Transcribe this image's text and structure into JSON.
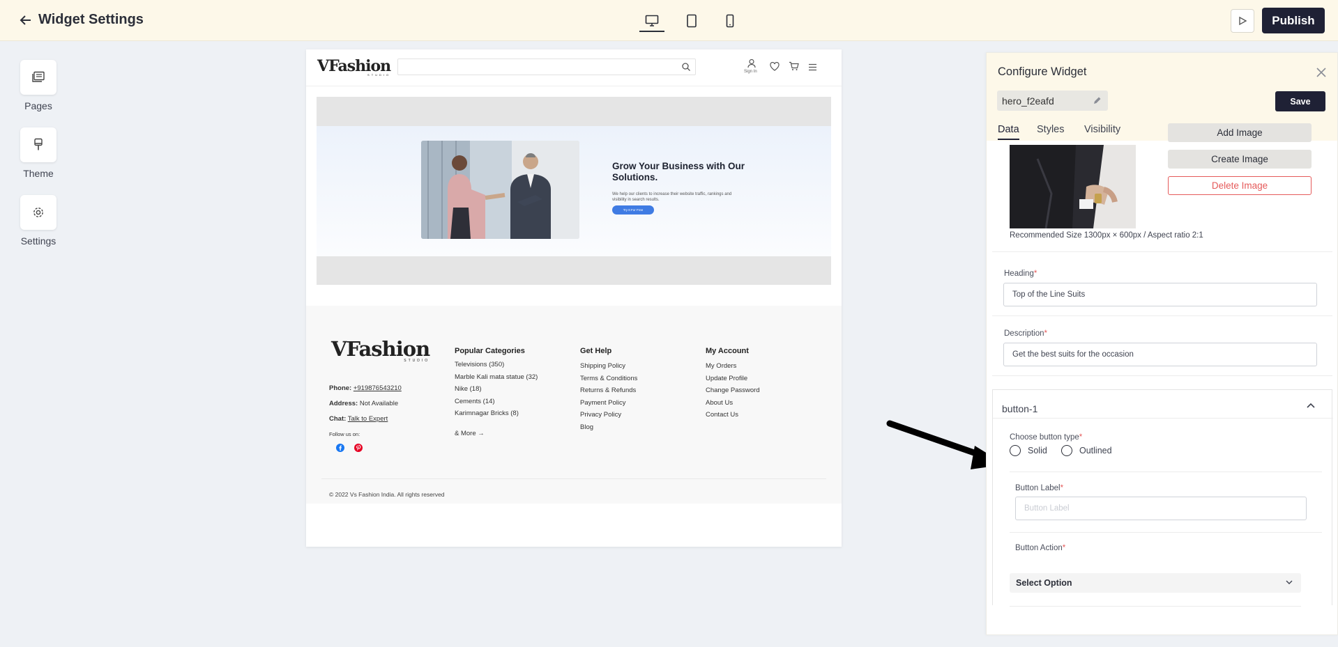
{
  "topbar": {
    "title": "Widget Settings",
    "publish_label": "Publish",
    "devices": [
      "desktop-icon",
      "tablet-icon",
      "mobile-icon"
    ],
    "active_device": "desktop"
  },
  "rail": {
    "items": [
      {
        "label": "Pages",
        "icon": "pages-icon"
      },
      {
        "label": "Theme",
        "icon": "brush-icon"
      },
      {
        "label": "Settings",
        "icon": "gear-icon"
      }
    ]
  },
  "preview": {
    "header": {
      "logo_main": "VFashion",
      "logo_sub": "STUDIO",
      "signin": "Sign In"
    },
    "hero": {
      "heading": "Grow Your Business with Our Solutions.",
      "text": "We help our clients to increase their website traffic, rankings and visibility in search results.",
      "button": "Try It For Free"
    },
    "footer": {
      "logo_main": "VFashion",
      "logo_sub": "STUDIO",
      "phone_label": "Phone:",
      "phone_value": "+919876543210",
      "address_label": "Address:",
      "address_value": "Not Available",
      "chat_label": "Chat:",
      "chat_value": "Talk to Expert",
      "follow": "Follow us on:",
      "columns": [
        {
          "title": "Popular Categories",
          "items": [
            "Televisions (350)",
            "Marble Kali mata statue (32)",
            "Nike (18)",
            "Cements (14)",
            "Karimnagar Bricks (8)"
          ],
          "more": "& More"
        },
        {
          "title": "Get Help",
          "items": [
            "Shipping Policy",
            "Terms & Conditions",
            "Returns & Refunds",
            "Payment Policy",
            "Privacy Policy",
            "Blog"
          ]
        },
        {
          "title": "My Account",
          "items": [
            "My Orders",
            "Update Profile",
            "Change Password",
            "About Us",
            "Contact Us"
          ]
        }
      ],
      "copyright": "© 2022 Vs Fashion India. All rights reserved"
    }
  },
  "panel": {
    "title": "Configure Widget",
    "widget_name": "hero_f2eafd",
    "save_label": "Save",
    "tabs": [
      "Data",
      "Styles",
      "Visibility"
    ],
    "active_tab": "Data",
    "image_buttons": {
      "add": "Add Image",
      "create": "Create Image",
      "delete": "Delete Image"
    },
    "recommended_size": "Recommended Size 1300px × 600px / Aspect ratio 2:1",
    "heading_label": "Heading",
    "heading_value": "Top of the Line Suits",
    "description_label": "Description",
    "description_value": "Get the best suits for the occasion",
    "required_mark": "*",
    "button_section": {
      "title": "button-1",
      "type_label": "Choose button type",
      "options": [
        "Solid",
        "Outlined"
      ],
      "label_field": "Button Label",
      "label_placeholder": "Button Label",
      "action_field": "Button Action",
      "action_value": "Select Option"
    }
  },
  "colors": {
    "topbar_bg": "#fdf8e9",
    "primary": "#1f2135",
    "danger": "#e55a5a",
    "hero_button": "#3f7be3"
  }
}
